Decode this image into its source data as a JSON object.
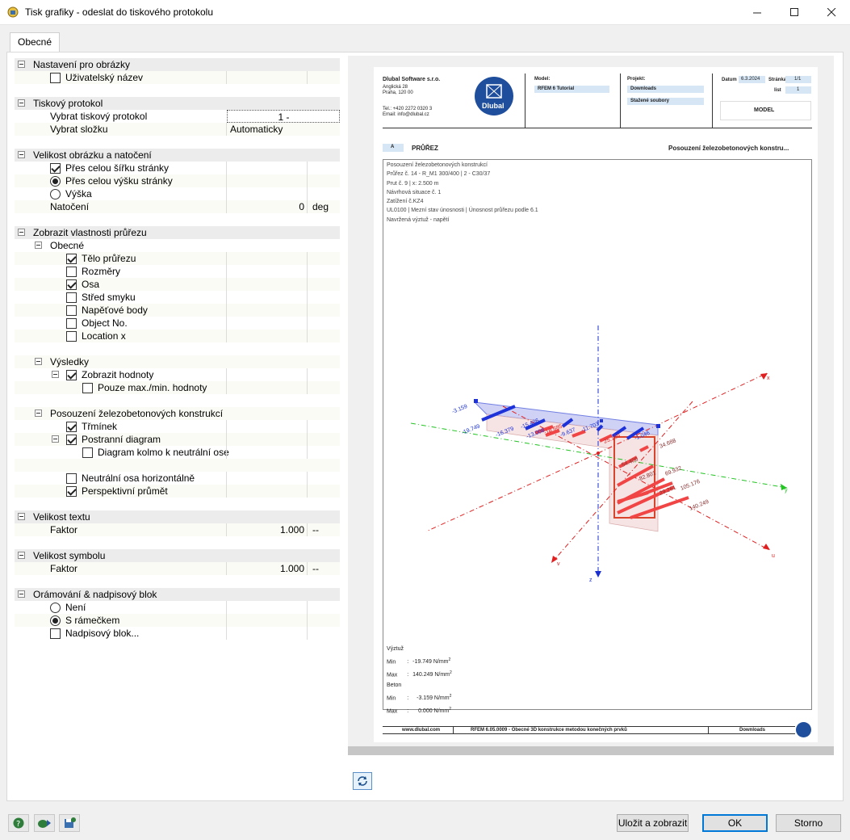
{
  "window": {
    "title": "Tisk grafiky - odeslat do tiskového protokolu",
    "min_icon": "minimize-icon",
    "max_icon": "maximize-icon",
    "close_icon": "close-icon"
  },
  "tabs": [
    {
      "label": "Obecné",
      "active": true
    }
  ],
  "panel": {
    "s1": {
      "title": "Nastavení pro obrázky",
      "user_name": "Uživatelský název"
    },
    "s2": {
      "title": "Tiskový protokol",
      "select_protocol": "Vybrat tiskový protokol",
      "protocol_value": "1 -",
      "select_folder": "Vybrat složku",
      "folder_value": "Automaticky"
    },
    "s3": {
      "title": "Velikost obrázku a natočení",
      "full_width": "Přes celou šířku stránky",
      "full_height": "Přes celou výšku stránky",
      "height": "Výška",
      "rotation": "Natočení",
      "rotation_value": "0",
      "rotation_unit": "deg"
    },
    "s4": {
      "title": "Zobrazit vlastnosti průřezu",
      "general": "Obecné",
      "body": "Tělo průřezu",
      "dims": "Rozměry",
      "axis": "Osa",
      "shear_center": "Střed smyku",
      "stress_points": "Napěťové body",
      "object_no": "Object No.",
      "location_x": "Location x",
      "results": "Výsledky",
      "show_values": "Zobrazit hodnoty",
      "only_minmax": "Pouze max./min. hodnoty",
      "rc_design": "Posouzení železobetonových konstrukcí",
      "stirrup": "Třmínek",
      "side_diagram": "Postranní diagram",
      "diagram_perp": "Diagram kolmo k neutrální ose",
      "neutral_horizontal": "Neutrální osa horizontálně",
      "perspective": "Perspektivní průmět"
    },
    "s5": {
      "title": "Velikost textu",
      "factor": "Faktor",
      "factor_value": "1.000",
      "unit": "--"
    },
    "s6": {
      "title": "Velikost symbolu",
      "factor": "Faktor",
      "factor_value": "1.000",
      "unit": "--"
    },
    "s7": {
      "title": "Orámování & nadpisový blok",
      "none": "Není",
      "frame": "S rámečkem",
      "title_block": "Nadpisový blok..."
    }
  },
  "page": {
    "company": "Dlubal Software s.r.o.",
    "address1": "Anglická 28",
    "address2": "Praha, 120 00",
    "tel": "Tel.: +420 2272 0320 3",
    "email": "Email: info@dlubal.cz",
    "logo_text": "Dlubal",
    "model_label": "Model:",
    "model_value": "RFEM 6 Tutorial",
    "project_label": "Projekt:",
    "project_value1": "Downloads",
    "project_value2": "Stažené soubory",
    "date_label": "Datum",
    "date_value": "6.3.2024",
    "page_label": "Stránka",
    "page_value": "1/1",
    "sheet_label": "list",
    "sheet_value": "1",
    "model_tag": "MODEL",
    "section_letter": "A",
    "section_title": "PRŮŘEZ",
    "section_right": "Posouzení železobetonových konstru...",
    "info_lines": [
      "Posouzení železobetonových konstrukcí",
      "Průřez č. 14 - R_M1 300/400 | 2 - C30/37",
      "Prut č. 9 | x: 2.500 m",
      "Návrhová situace č. 1",
      "Zatížení č.KZ4",
      "UL0100 | Mezní stav únosnosti | Únosnost průřezu podle 6.1",
      "Navržená výztuž - napětí"
    ],
    "legend": {
      "rebar_title": "Výztuž",
      "min_label": "Min",
      "max_label": "Max",
      "rebar_min": "-19.749 N/mm",
      "rebar_max": "140.249 N/mm",
      "concrete_title": "Beton",
      "concrete_min": "-3.159 N/mm",
      "concrete_max": "0.000 N/mm",
      "sup": "2",
      "colon": ":"
    },
    "diagram_labels": {
      "l1": "-3.159",
      "l2": "-19.749",
      "l3": "-16.379",
      "l4": "-15.496",
      "l5": "-13.008",
      "l6": "-18.685",
      "l7": "-9.637",
      "l8": "-11.703",
      "l9": "-1.046",
      "l10": "25.169",
      "l11": "34.688",
      "l12": "54.406",
      "l13": "69.932",
      "l14": "105.176",
      "l15": "140.249",
      "l16": "82.801",
      "l17": "29.261",
      "ax_x": "x",
      "ax_y": "y",
      "ax_z": "z",
      "ax_u": "u",
      "ax_v": "v"
    },
    "footer_site": "www.dlubal.com",
    "footer_program": "RFEM 6.05.0009 - Obecné 3D konstrukce metodou konečných prvků",
    "footer_downloads": "Downloads"
  },
  "buttons": {
    "save_show": "Uložit a zobrazit",
    "ok": "OK",
    "cancel": "Storno"
  },
  "colors": {
    "accent": "#0078d7",
    "dlubal_blue": "#1f4e9c"
  }
}
